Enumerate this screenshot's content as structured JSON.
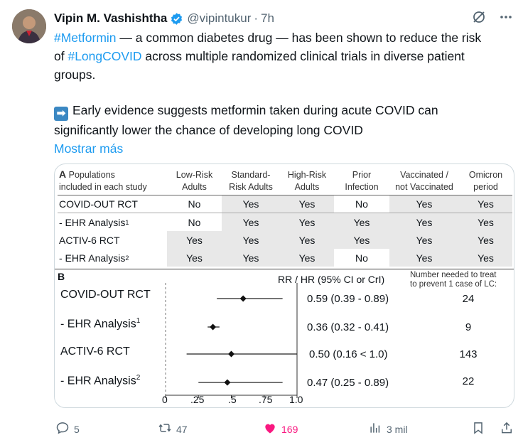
{
  "tweet": {
    "name": "Vipin M. Vashishtha",
    "handle": "@vipintukur",
    "separator": "·",
    "time": "7h",
    "line1_tag": "#Metformin",
    "line1_rest": " — a common diabetes drug — has been shown to reduce the risk",
    "line2_pre": "of ",
    "line2_tag": "#LongCOVID",
    "line2_rest": " across multiple randomized clinical trials in diverse patient",
    "line3": "groups.",
    "arrow_glyph": "➡",
    "line4": "Early evidence suggests metformin taken during acute COVID can",
    "line5": "significantly lower the chance of developing long COVID",
    "show_more": "Mostrar más"
  },
  "figure": {
    "a_label": "A",
    "a_title1": "Populations",
    "a_title2": "included in each study",
    "columns": [
      [
        "Low-Risk",
        "Adults"
      ],
      [
        "Standard-",
        "Risk Adults"
      ],
      [
        "High-Risk",
        "Adults"
      ],
      [
        "Prior",
        "Infection"
      ],
      [
        "Vaccinated /",
        "not Vaccinated"
      ],
      [
        "Omicron",
        "period"
      ]
    ],
    "rows": [
      {
        "label": "COVID-OUT RCT",
        "sup": "",
        "cells": [
          "No",
          "Yes",
          "Yes",
          "No",
          "Yes",
          "Yes"
        ]
      },
      {
        "label": "- EHR Analysis",
        "sup": "1",
        "cells": [
          "No",
          "Yes",
          "Yes",
          "Yes",
          "Yes",
          "Yes"
        ]
      },
      {
        "label": "ACTIV-6 RCT",
        "sup": "",
        "cells": [
          "Yes",
          "Yes",
          "Yes",
          "Yes",
          "Yes",
          "Yes"
        ]
      },
      {
        "label": "- EHR Analysis",
        "sup": "2",
        "cells": [
          "Yes",
          "Yes",
          "Yes",
          "No",
          "Yes",
          "Yes"
        ]
      }
    ],
    "b_label": "B",
    "rr_header": "RR / HR (95% CI or CrI)",
    "nnt_header1": "Number needed to treat",
    "nnt_header2": "to prevent 1 case of LC:",
    "forest": [
      {
        "label": "COVID-OUT RCT",
        "sup": "",
        "point": 0.59,
        "low": 0.39,
        "high": 0.89,
        "text": "0.59 (0.39 - 0.89)",
        "nnt": "24"
      },
      {
        "label": "- EHR Analysis",
        "sup": "1",
        "point": 0.36,
        "low": 0.32,
        "high": 0.41,
        "text": "0.36 (0.32 - 0.41)",
        "nnt": "9"
      },
      {
        "label": "ACTIV-6 RCT",
        "sup": "",
        "point": 0.5,
        "low": 0.16,
        "high": 1.0,
        "text": "0.50 (0.16 < 1.0)",
        "nnt": "143"
      },
      {
        "label": "- EHR Analysis",
        "sup": "2",
        "point": 0.47,
        "low": 0.25,
        "high": 0.89,
        "text": "0.47 (0.25 - 0.89)",
        "nnt": "22"
      }
    ],
    "ticks": [
      "0",
      ".25",
      ".5",
      ".75",
      "1.0"
    ]
  },
  "actions": {
    "replies": "5",
    "retweets": "47",
    "likes": "169",
    "views": "3 mil"
  },
  "colors": {
    "link": "#1d9bf0",
    "like": "#f91880",
    "muted": "#536471",
    "verified": "#1d9bf0"
  },
  "icons": [
    "verified-badge-icon",
    "grok-icon",
    "more-icon",
    "reply-icon",
    "retweet-icon",
    "heart-icon",
    "views-icon",
    "bookmark-icon",
    "share-icon"
  ]
}
